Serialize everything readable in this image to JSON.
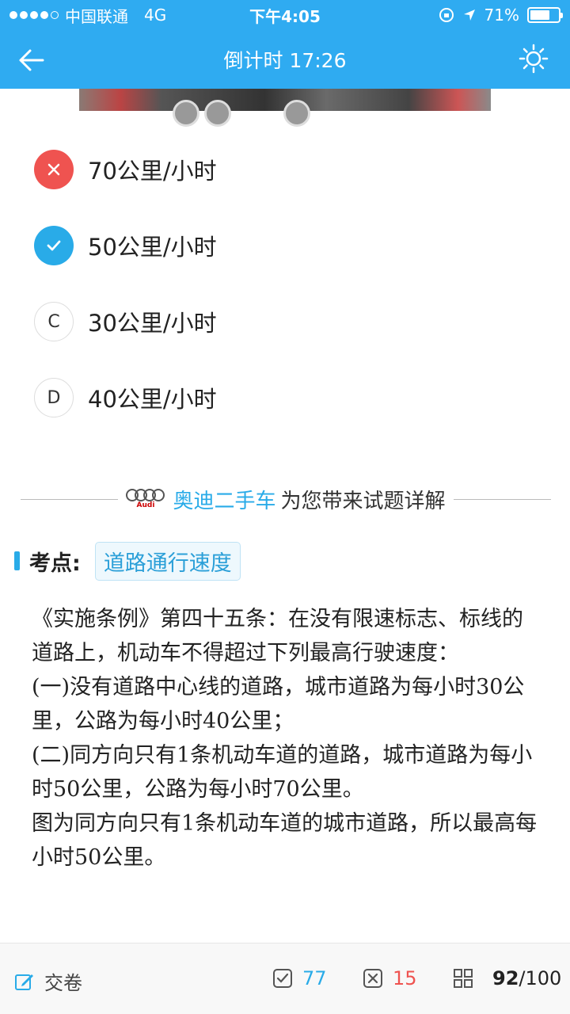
{
  "status_bar": {
    "carrier": "中国联通",
    "network": "4G",
    "time": "下午4:05",
    "battery_percent": "71%",
    "battery_level": 0.71
  },
  "nav": {
    "title": "倒计时 17:26",
    "back_icon": "arrow-left-icon",
    "theme_icon": "sun-icon"
  },
  "options": [
    {
      "mark": "×",
      "text": "70公里/小时",
      "state": "wrong"
    },
    {
      "mark": "✓",
      "text": "50公里/小时",
      "state": "correct"
    },
    {
      "mark": "C",
      "text": "30公里/小时",
      "state": "none"
    },
    {
      "mark": "D",
      "text": "40公里/小时",
      "state": "none"
    }
  ],
  "sponsor": {
    "logo_text": "Audi",
    "brand": "奥迪二手车",
    "text": "为您带来试题详解"
  },
  "exam_point": {
    "label": "考点:",
    "tag": "道路通行速度"
  },
  "explanation": [
    "《实施条例》第四十五条：在没有限速标志、标线的道路上，机动车不得超过下列最高行驶速度：",
    "(一)没有道路中心线的道路，城市道路为每小时30公里，公路为每小时40公里；",
    "(二)同方向只有1条机动车道的道路，城市道路为每小时50公里，公路为每小时70公里。",
    "图为同方向只有1条机动车道的城市道路，所以最高每小时50公里。"
  ],
  "bottom_bar": {
    "submit_label": "交卷",
    "correct_count": "77",
    "wrong_count": "15",
    "progress_current": "92",
    "progress_total": "/100"
  },
  "colors": {
    "accent": "#2fabf1",
    "correct": "#29abe8",
    "wrong": "#ef5350"
  }
}
